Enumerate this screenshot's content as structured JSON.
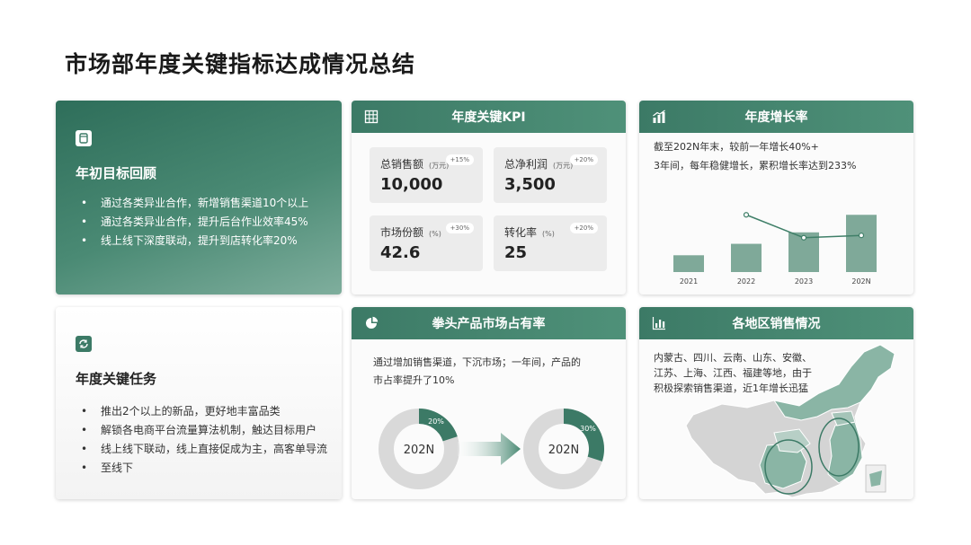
{
  "page": {
    "title": "市场部年度关键指标达成情况总结"
  },
  "review": {
    "title": "年初目标回顾",
    "items": [
      "通过各类异业合作，新增销售渠道10个以上",
      "通过各类异业合作，提升后台作业效率45%",
      "线上线下深度联动，提升到店转化率20%"
    ]
  },
  "tasks": {
    "title": "年度关键任务",
    "items": [
      "推出2个以上的新品，更好地丰富品类",
      "解锁各电商平台流量算法机制，触达目标用户",
      "线上线下联动，线上直接促成为主，高客单导流",
      "至线下"
    ]
  },
  "kpi": {
    "title": "年度关键KPI",
    "cards": [
      {
        "label": "总销售额",
        "unit": "(万元)",
        "change": "+15%",
        "value": "10,000"
      },
      {
        "label": "总净利润",
        "unit": "(万元)",
        "change": "+20%",
        "value": "3,500"
      },
      {
        "label": "市场份额",
        "unit": "(%)",
        "change": "+30%",
        "value": "42.6"
      },
      {
        "label": "转化率",
        "unit": "(%)",
        "change": "+20%",
        "value": "25"
      }
    ]
  },
  "growth": {
    "title": "年度增长率",
    "line1": "截至202N年末，较前一年增长40%+",
    "line2": "3年间，每年稳健增长，累积增长率达到233%"
  },
  "chart_data": {
    "type": "bar",
    "categories": [
      "2021",
      "2022",
      "2023",
      "202N"
    ],
    "values": [
      22,
      37,
      52,
      75
    ],
    "line_values": [
      null,
      75,
      45,
      48
    ],
    "ylim": [
      0,
      100
    ],
    "grid": false,
    "color": "#7fa999",
    "line_color": "#3f7f68"
  },
  "share": {
    "title": "拳头产品市场占有率",
    "text1": "通过增加销售渠道，下沉市场；一年间，产品的",
    "text2": "市占率提升了10%",
    "donuts": [
      {
        "label": "202N",
        "pct_label": "20%",
        "pct": 20
      },
      {
        "label": "202N",
        "pct_label": "30%",
        "pct": 30
      }
    ]
  },
  "region": {
    "title": "各地区销售情况",
    "line1": "内蒙古、四川、云南、山东、安徽、",
    "line2": "江苏、上海、江西、福建等地，由于",
    "line3": "积极探索销售渠道，近1年增长迅猛"
  },
  "colors": {
    "accent": "#3c7a66",
    "accent_light": "#7fae9d",
    "grey": "#d9d9d9"
  }
}
